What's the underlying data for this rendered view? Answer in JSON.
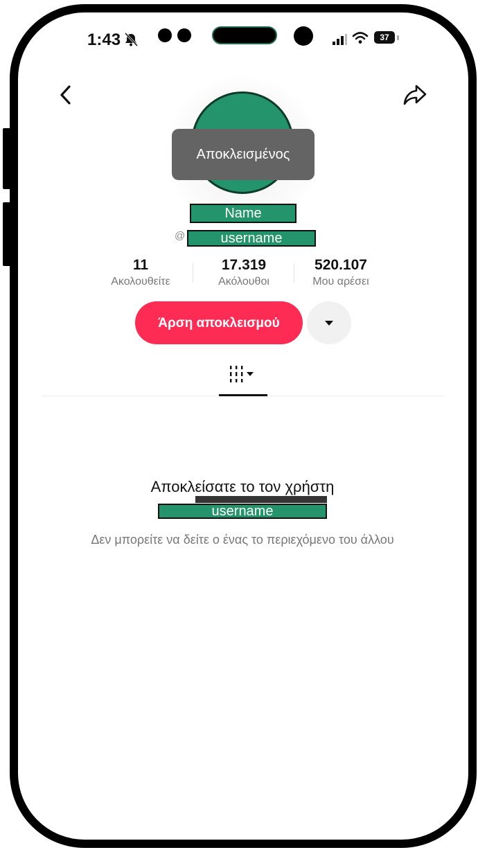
{
  "status_bar": {
    "time": "1:43",
    "battery": "37"
  },
  "profile": {
    "blocked_toast": "Αποκλεισμένος",
    "name": "Name",
    "at_symbol": "@",
    "username": "username"
  },
  "stats": [
    {
      "value": "11",
      "label": "Ακολουθείτε"
    },
    {
      "value": "17.319",
      "label": "Ακόλουθοι"
    },
    {
      "value": "520.107",
      "label": "Μου αρέσει"
    }
  ],
  "actions": {
    "unblock_label": "Άρση αποκλεισμού"
  },
  "empty_state": {
    "title": "Αποκλείσατε το τον χρήστη",
    "username": "username",
    "description": "Δεν μπορείτε να δείτε ο ένας το περιεχόμενο του άλλου"
  },
  "colors": {
    "accent": "#fe2c55",
    "redaction": "#23946c"
  }
}
